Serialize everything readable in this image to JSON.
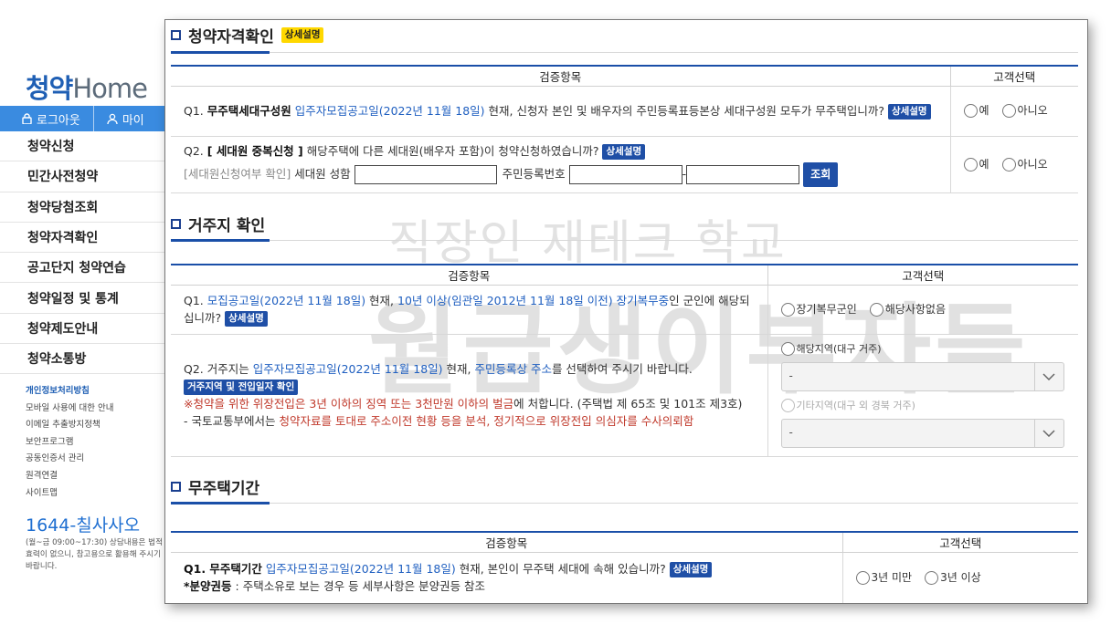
{
  "sidebar": {
    "logo_prefix": "청약",
    "logo_suffix": "Home",
    "login_label": "로그아웃",
    "mypage_label": "마이",
    "nav": [
      "청약신청",
      "민간사전청약",
      "청약당첨조회",
      "청약자격확인",
      "공고단지 청약연습",
      "청약일정 및 통계",
      "청약제도안내",
      "청약소통방"
    ],
    "links": [
      "개인정보처리방침",
      "모바일 사용에 대한 안내",
      "이메일 추출방지정책",
      "보안프로그램",
      "공동인증서 관리",
      "원격연결",
      "사이트맵"
    ],
    "phone": "1644-칠사사오",
    "hours_text": "(월~금 09:00~17:30) 상담내용은 법적효력이 없으니, 참고용으로 활용해 주시기 바랍니다."
  },
  "watermark": {
    "line1": "직장인 재테크 학교",
    "line2": "월급생이부자들"
  },
  "common": {
    "detail_badge": "상세설명",
    "col_item": "검증항목",
    "col_choice": "고객선택"
  },
  "section1": {
    "title": "청약자격확인",
    "q1": {
      "prefix": "Q1. ",
      "bold": "무주택세대구성원",
      "blue": " 입주자모집공고일(2022년 11월 18일)",
      "rest": " 현재, 신청자 본인 및 배우자의 주민등록표등본상 세대구성원 모두가 무주택입니까?"
    },
    "q2": {
      "prefix": "Q2. ",
      "bold": "[ 세대원 중복신청 ]",
      "rest": " 해당주택에 다른 세대원(배우자 포함)이 청약신청하였습니까?",
      "sub_gray": "[세대원신청여부 확인]",
      "name_label": " 세대원 성함",
      "rrn_label": "주민등록번호",
      "dash": "-",
      "search_button": "조회"
    },
    "yes": "예",
    "no": "아니오"
  },
  "section2": {
    "title": "거주지 확인",
    "q1": {
      "prefix": "Q1. ",
      "blue1": "모집공고일(2022년 11월 18일)",
      "t1": " 현재, ",
      "blue2": "10년 이상(임관일 2012년 11월 18일 이전) 장기복무중",
      "t2": "인 군인에 해당되십니까?"
    },
    "opt_long": "장기복무군인",
    "opt_none": "해당사항없음",
    "q2": {
      "prefix": "Q2. 거주지는 ",
      "blue1": "입주자모집공고일(2022년 11월 18일)",
      "t1": " 현재, ",
      "blue2": "주민등록상 주소",
      "t2": "를 선택하여 주시기 바랍니다.",
      "badge": "거주지역 및 전입일자 확인",
      "warn_a": "※",
      "warn_red": "청약을 위한 위장전입은 3년 이하의 징역 또는 3천만원 이하의 벌금",
      "warn_b": "에 처합니다. (주택법 제 65조 및 101조 제3호)",
      "note_a": "- 국토교통부에서는 ",
      "note_red": "청약자료를 토대로 주소이전 현황 등을 분석, 정기적으로 위장전입 의심자를 수사의뢰함"
    },
    "opt_area": "해당지역(대구 거주)",
    "opt_other": "기타지역(대구 외 경북 거주)",
    "select_value": "-"
  },
  "section3": {
    "title": "무주택기간",
    "q1": {
      "prefix": "Q1. 무주택기간",
      "blue": " 입주자모집공고일(2022년 11월 18일)",
      "rest": " 현재, 본인이 무주택 세대에 속해 있습니까?",
      "note_bold": "*분양권등",
      "note_rest": " : 주택소유로 보는 경우 등 세부사항은 분양권등 참조"
    },
    "opt_under": "3년 미만",
    "opt_over": "3년 이상"
  }
}
